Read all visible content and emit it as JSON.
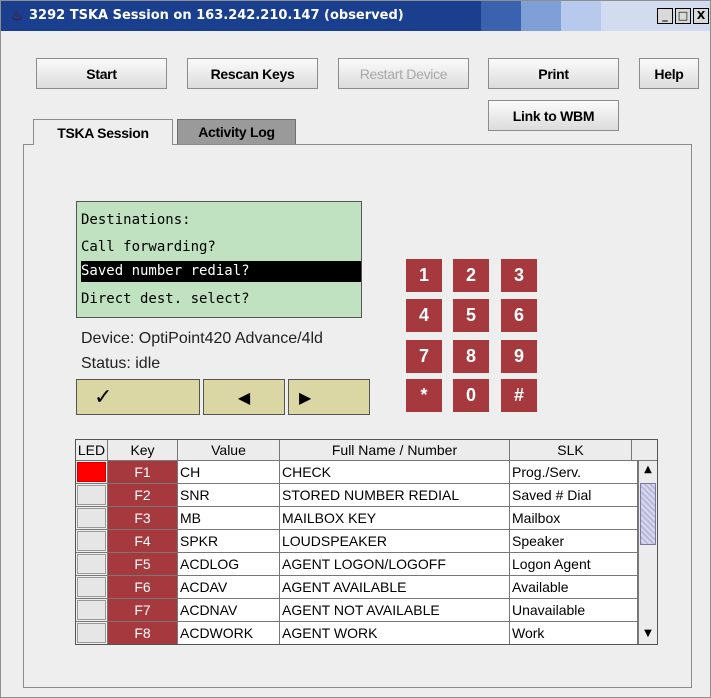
{
  "window": {
    "title": "3292 TSKA Session on 163.242.210.147 (observed)",
    "app_icon": "java-app-icon",
    "controls": [
      "_",
      "□",
      "X"
    ]
  },
  "toolbar": {
    "start": "Start",
    "rescan": "Rescan Keys",
    "restart": "Restart Device",
    "print": "Print",
    "help": "Help",
    "link_wbm": "Link to WBM"
  },
  "tabs": [
    {
      "label": "TSKA Session",
      "active": true
    },
    {
      "label": "Activity Log",
      "active": false
    }
  ],
  "display": {
    "lines": [
      "Destinations:",
      "Call forwarding?",
      "Saved number redial?",
      "Direct dest. select?"
    ],
    "selected_line": 2
  },
  "device": "Device: OptiPoint420 Advance/4ld",
  "status": "Status: idle",
  "nav": {
    "ok": "✓",
    "left": "◀",
    "right": "▶"
  },
  "keypad": [
    "1",
    "2",
    "3",
    "4",
    "5",
    "6",
    "7",
    "8",
    "9",
    "*",
    "0",
    "#"
  ],
  "table": {
    "columns": [
      "LED",
      "Key",
      "Value",
      "Full Name / Number",
      "SLK"
    ],
    "rows": [
      {
        "led": "red",
        "key": "F1",
        "value": "CH",
        "name": "CHECK",
        "slk": "Prog./Serv."
      },
      {
        "led": "off",
        "key": "F2",
        "value": "SNR",
        "name": "STORED NUMBER REDIAL",
        "slk": "Saved # Dial"
      },
      {
        "led": "off",
        "key": "F3",
        "value": "MB",
        "name": "MAILBOX KEY",
        "slk": "Mailbox"
      },
      {
        "led": "off",
        "key": "F4",
        "value": "SPKR",
        "name": "LOUDSPEAKER",
        "slk": "Speaker"
      },
      {
        "led": "off",
        "key": "F5",
        "value": "ACDLOG",
        "name": "AGENT LOGON/LOGOFF",
        "slk": "Logon Agent"
      },
      {
        "led": "off",
        "key": "F6",
        "value": "ACDAV",
        "name": "AGENT AVAILABLE",
        "slk": "Available"
      },
      {
        "led": "off",
        "key": "F7",
        "value": "ACDNAV",
        "name": "AGENT NOT AVAILABLE",
        "slk": "Unavailable"
      },
      {
        "led": "off",
        "key": "F8",
        "value": "ACDWORK",
        "name": "AGENT WORK",
        "slk": "Work"
      }
    ]
  },
  "colors": {
    "titlebar": "#1b3f8f",
    "lcd": "#c0e2c0",
    "key_red": "#a5393d",
    "nav_khaki": "#dad7a4",
    "led_on": "#ff0000"
  }
}
